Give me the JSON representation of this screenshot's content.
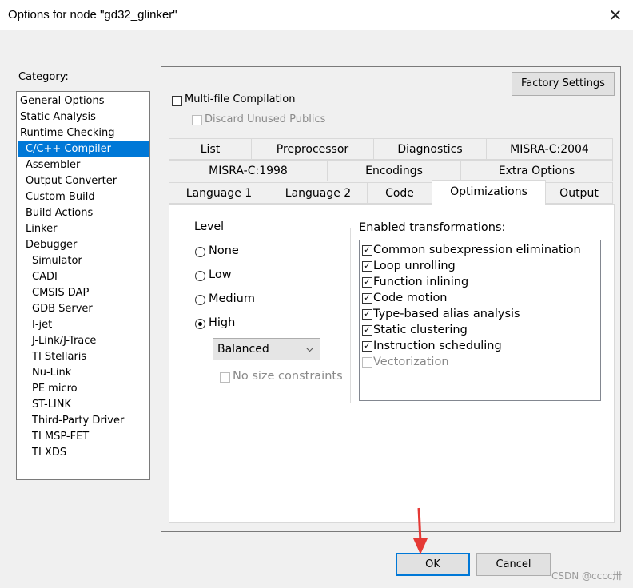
{
  "window": {
    "title": "Options for node \"gd32_glinker\"",
    "close_glyph": "✕"
  },
  "category": {
    "label": "Category:",
    "items": [
      {
        "label": "General Options"
      },
      {
        "label": "Static Analysis"
      },
      {
        "label": "Runtime Checking"
      },
      {
        "label": "C/C++ Compiler",
        "selected": true
      },
      {
        "label": "Assembler"
      },
      {
        "label": "Output Converter"
      },
      {
        "label": "Custom Build"
      },
      {
        "label": "Build Actions"
      },
      {
        "label": "Linker"
      },
      {
        "label": "Debugger"
      },
      {
        "label": "Simulator"
      },
      {
        "label": "CADI"
      },
      {
        "label": "CMSIS DAP"
      },
      {
        "label": "GDB Server"
      },
      {
        "label": "I-jet"
      },
      {
        "label": "J-Link/J-Trace"
      },
      {
        "label": "TI Stellaris"
      },
      {
        "label": "Nu-Link"
      },
      {
        "label": "PE micro"
      },
      {
        "label": "ST-LINK"
      },
      {
        "label": "Third-Party Driver"
      },
      {
        "label": "TI MSP-FET"
      },
      {
        "label": "TI XDS"
      }
    ]
  },
  "factory_settings": "Factory Settings",
  "multi_file": {
    "label": "Multi-file Compilation",
    "checked": false
  },
  "discard_unused": {
    "label": "Discard Unused Publics",
    "checked": false,
    "disabled": true
  },
  "tabs": {
    "row1": [
      "List",
      "Preprocessor",
      "Diagnostics",
      "MISRA-C:2004"
    ],
    "row2": [
      "MISRA-C:1998",
      "Encodings",
      "Extra Options"
    ],
    "row3": [
      "Language 1",
      "Language 2",
      "Code",
      "Optimizations",
      "Output"
    ],
    "active": "Optimizations"
  },
  "level": {
    "label": "Level",
    "options": [
      "None",
      "Low",
      "Medium",
      "High"
    ],
    "selected": "High",
    "combo_value": "Balanced",
    "no_size": {
      "label": "No size constraints",
      "checked": false,
      "disabled": true
    }
  },
  "transformations": {
    "label": "Enabled transformations:",
    "items": [
      {
        "label": "Common subexpression elimination",
        "checked": true
      },
      {
        "label": "Loop unrolling",
        "checked": true
      },
      {
        "label": "Function inlining",
        "checked": true
      },
      {
        "label": "Code motion",
        "checked": true
      },
      {
        "label": "Type-based alias analysis",
        "checked": true
      },
      {
        "label": "Static clustering",
        "checked": true
      },
      {
        "label": "Instruction scheduling",
        "checked": true
      },
      {
        "label": "Vectorization",
        "checked": false,
        "disabled": true
      }
    ]
  },
  "buttons": {
    "ok": "OK",
    "cancel": "Cancel"
  },
  "watermark": "CSDN @cccc卅",
  "colors": {
    "selection": "#0078d7",
    "arrow": "#e53935"
  }
}
